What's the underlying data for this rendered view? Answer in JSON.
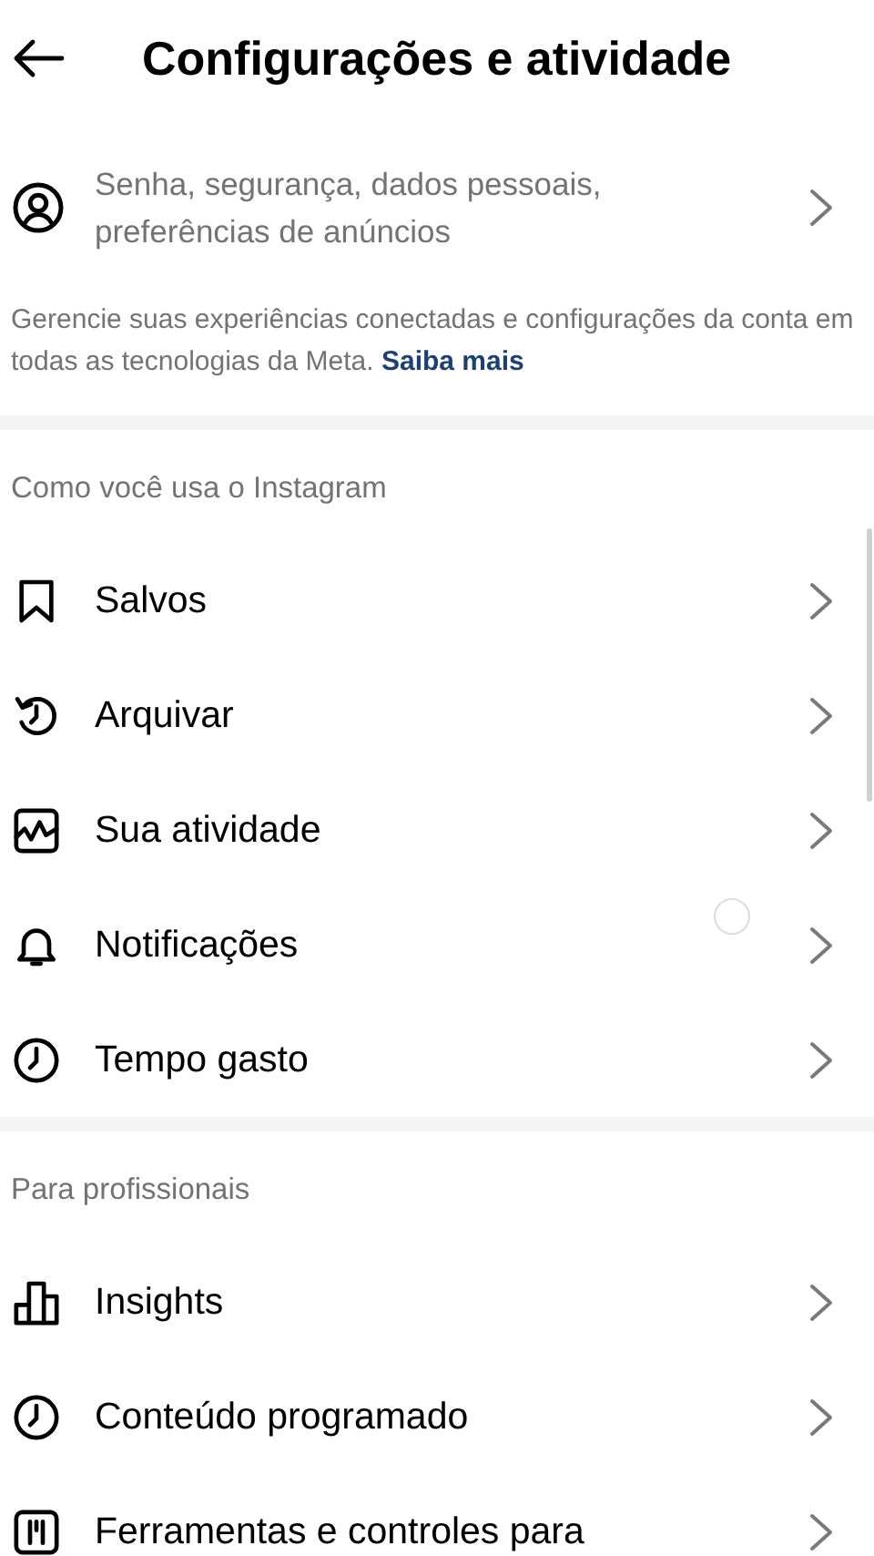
{
  "header": {
    "title": "Configurações e atividade"
  },
  "account_center": {
    "subtitle": "Senha, segurança, dados pessoais, preferências de anúncios"
  },
  "description": {
    "text": "Gerencie suas experiências conectadas e configurações da conta em todas as tecnologias da Meta.",
    "link": "Saiba mais"
  },
  "sections": [
    {
      "title": "Como você usa o Instagram",
      "items": [
        {
          "label": "Salvos"
        },
        {
          "label": "Arquivar"
        },
        {
          "label": "Sua atividade"
        },
        {
          "label": "Notificações"
        },
        {
          "label": "Tempo gasto"
        }
      ]
    },
    {
      "title": "Para profissionais",
      "items": [
        {
          "label": "Insights"
        },
        {
          "label": "Conteúdo programado"
        },
        {
          "label": "Ferramentas e controles para"
        }
      ]
    }
  ]
}
